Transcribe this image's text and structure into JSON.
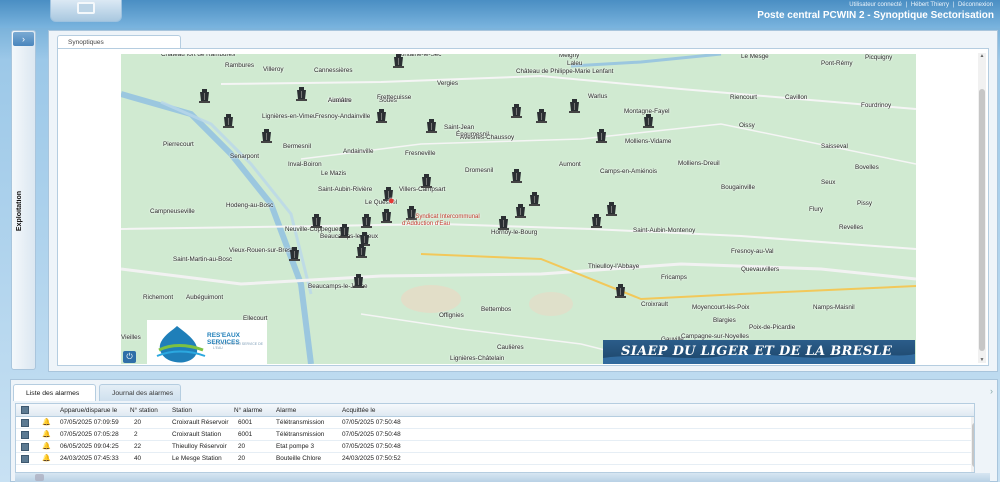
{
  "header": {
    "user_label": "Utilisateur connecté",
    "user_name": "Hébert Thierry",
    "separator": "|",
    "logout": "Déconnexion",
    "title": "Poste central PCWIN 2 - Synoptique Sectorisation"
  },
  "side_panel": {
    "toggle_icon": "›",
    "label": "Exploitation"
  },
  "synoptic": {
    "tab_label": "Synoptiques",
    "pin_icon": "water-station-icon",
    "pin_color": "#2b2f33",
    "siaep_marker": "Syndicat Intercommunal\nd'Adduction d'Eau",
    "logo_name": "RES'EAUX SERVICES",
    "logo_sub": "L'EXPERTISE AU SERVICE DE L'EAU",
    "banner": "SIAEP DU LIGER ET DE LA BRESLE",
    "power_icon": "⏻",
    "places": [
      "Château fort de Rambures",
      "Rambures",
      "Villeroy",
      "Cannessières",
      "Fontaine-le-Sec",
      "Méigny",
      "Laleu",
      "Le Mesge",
      "Pont-Rémy",
      "Picquigny",
      "Vergies",
      "Château de Philippe-Marie Lenfant",
      "Airaines",
      "Soues",
      "Riencourt",
      "Cavillon",
      "Frettecuisse",
      "Warlus",
      "Fourdrinoy",
      "Lignières-en-Vimeu",
      "Fresnoy-Andainville",
      "Aumâtre",
      "Épaumesnil",
      "Montagne-Fayel",
      "Oissy",
      "Saint-Jean",
      "Avesnes-Chaussoy",
      "Molliens-Vidame",
      "Pierrecourt",
      "Bermesnil",
      "Senarpont",
      "Inval-Boiron",
      "Andainville",
      "Fresneville",
      "Aumont",
      "Saisseval",
      "Camps-en-Amiénois",
      "Molliens-Dreuil",
      "Dromesnil",
      "Le Mazis",
      "Bovelles",
      "Villers-Campsart",
      "Bougainville",
      "Saint-Aubin-Rivière",
      "Seux",
      "Hodeng-au-Bosc",
      "Le Quesnel",
      "Campneuseville",
      "Neuville-Coppegueule",
      "Hornoy-le-Bourg",
      "Flury",
      "Pissy",
      "Saint-Aubin-Montenoy",
      "Beaucamps-le-Vieux",
      "Revelles",
      "Fresnoy-au-Val",
      "Vieux-Rouen-sur-Bresle",
      "Saint-Martin-au-Bosc",
      "Thieulloy-l'Abbaye",
      "Quevauvillers",
      "Fricamps",
      "Beaucamps-le-Jeune",
      "Richemont",
      "Aubéguimont",
      "Offignies",
      "Bettembos",
      "Croixrault",
      "Namps-Maisnil",
      "Moyencourt-lès-Poix",
      "Poix-de-Picardie",
      "Ellecourt",
      "Vieilles",
      "Caulières",
      "Lignières-Châtelain",
      "Campagne-sur-Noyelles",
      "Gauville",
      "Blargies"
    ]
  },
  "alarms": {
    "tab_list": "Liste des alarmes",
    "tab_log": "Journal des alarmes",
    "columns": [
      "Apparue/disparue le",
      "N° station",
      "Station",
      "N° alarme",
      "Alarme",
      "Acquittée le"
    ],
    "rows": [
      [
        "07/05/2025 07:09:59",
        "20",
        "Croixrault Réservoir",
        "6001",
        "Télétransmission",
        "07/05/2025 07:50:48"
      ],
      [
        "07/05/2025 07:05:28",
        "2",
        "Croixrault Station",
        "6001",
        "Télétransmission",
        "07/05/2025 07:50:48"
      ],
      [
        "06/05/2025 09:04:25",
        "22",
        "Thieulloy Réservoir",
        "20",
        "Etat pompe 3",
        "07/05/2025 07:50:48"
      ],
      [
        "24/03/2025 07:45:33",
        "40",
        "Le Mesge Station",
        "20",
        "Bouteille Chlore",
        "24/03/2025 07:50:52"
      ]
    ],
    "row_icon": "bell-icon",
    "panel_arrow": "›"
  }
}
